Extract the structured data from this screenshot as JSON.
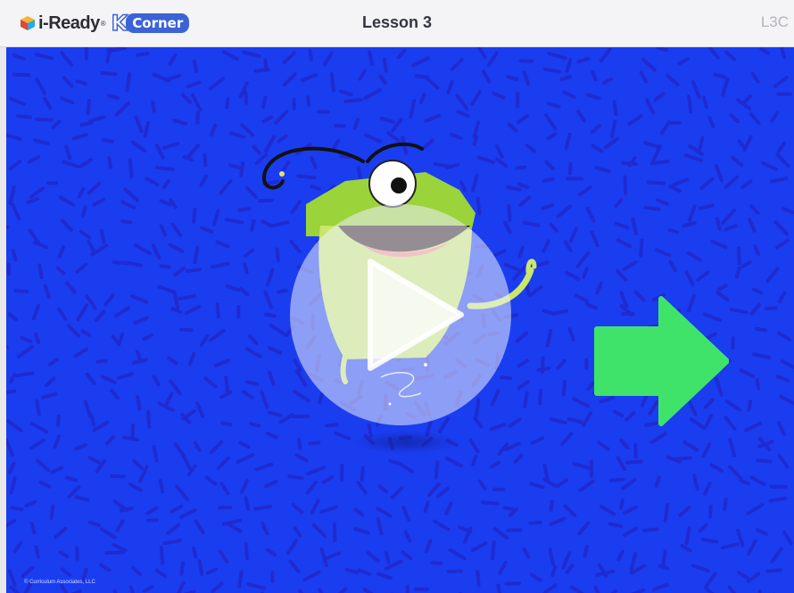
{
  "header": {
    "brand_name": "i-Ready",
    "brand_tm": "®",
    "kcorner_k": "K",
    "kcorner_word": "Corner",
    "lesson_title": "Lesson 3",
    "lesson_code": "L3C"
  },
  "stage": {
    "copyright": "© Curriculum Associates, LLC",
    "background_color": "#1a3df0",
    "confetti_color": "#1f2bd0",
    "play_icon": "play-icon",
    "next_icon": "right-arrow-icon",
    "next_color": "#3fe36a"
  }
}
